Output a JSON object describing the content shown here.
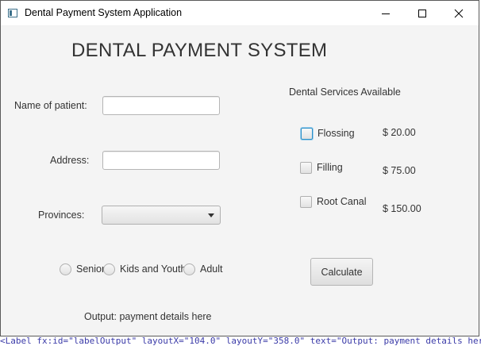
{
  "window": {
    "title": "Dental Payment System Application",
    "controls": [
      "minimize-icon",
      "maximize-icon",
      "close-icon"
    ]
  },
  "heading": "DENTAL PAYMENT SYSTEM",
  "form": {
    "patient_name_label": "Name of patient:",
    "patient_name_value": "",
    "address_label": "Address:",
    "address_value": "",
    "provinces_label": "Provinces:",
    "provinces_selected": ""
  },
  "age_groups": [
    {
      "label": "Senior",
      "selected": false
    },
    {
      "label": "Kids and Youth",
      "selected": false
    },
    {
      "label": "Adult",
      "selected": false
    }
  ],
  "services": {
    "header": "Dental Services Available",
    "items": [
      {
        "label": "Flossing",
        "price": "$ 20.00",
        "checked": false
      },
      {
        "label": "Filling",
        "price": "$ 75.00",
        "checked": false
      },
      {
        "label": "Root Canal",
        "price": "$ 150.00",
        "checked": false
      }
    ]
  },
  "calculate_label": "Calculate",
  "output_text": "Output: payment details here",
  "background_code": "<Label fx:id=\"labelOutput\" layoutX=\"104.0\" layoutY=\"358.0\" text=\"Output: payment details here\" />",
  "colors": {
    "focus_ring": "#2a8fc7",
    "window_bg": "#f4f4f4",
    "text": "#333333"
  }
}
